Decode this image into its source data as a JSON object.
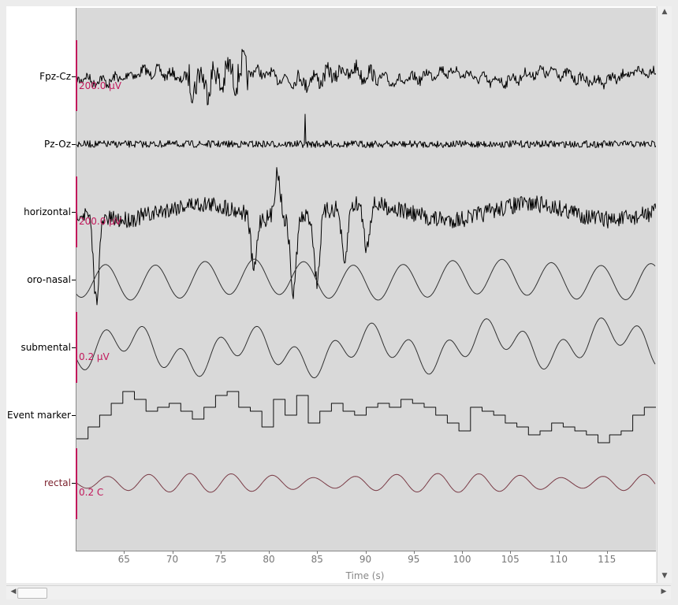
{
  "plot": {
    "channels": [
      {
        "label": "Fpz-Cz",
        "kind": "eeg",
        "scale": "200.0 µV",
        "color": "#000000"
      },
      {
        "label": "Pz-Oz",
        "kind": "eeg",
        "scale": "",
        "color": "#000000"
      },
      {
        "label": "horizontal",
        "kind": "eog",
        "scale": "200.0 µV",
        "color": "#000000"
      },
      {
        "label": "oro-nasal",
        "kind": "resp",
        "scale": "",
        "color": "#333333"
      },
      {
        "label": "submental",
        "kind": "emg",
        "scale": "0.2 µV",
        "color": "#333333"
      },
      {
        "label": "Event marker",
        "kind": "event",
        "scale": "",
        "color": "#111111"
      },
      {
        "label": "rectal",
        "kind": "temp",
        "scale": "0.2 C",
        "color": "#7a3b46"
      }
    ],
    "x_ticks": [
      "65",
      "70",
      "75",
      "80",
      "85",
      "90",
      "95",
      "100",
      "105",
      "110",
      "115"
    ],
    "xlabel": "Time (s)",
    "x_range": [
      60,
      120
    ]
  },
  "colors": {
    "background": "#d9d9d9",
    "scale_bar": "#c2185b",
    "temperature_trace": "#7a3b46"
  },
  "scrollbars": {
    "up_icon": "▲",
    "down_icon": "▼",
    "left_icon": "◀",
    "right_icon": "▶"
  }
}
